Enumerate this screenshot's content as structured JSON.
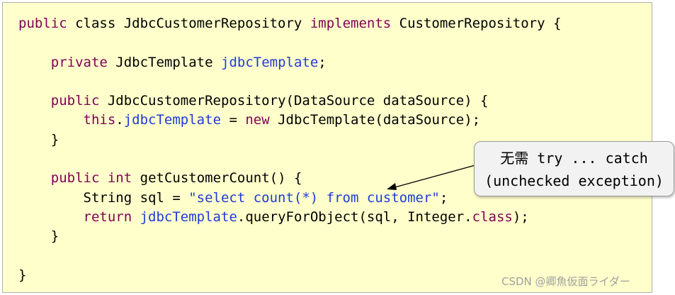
{
  "code_lines": [
    [
      {
        "t": "public",
        "c": "kw"
      },
      {
        "t": " class JdbcCustomerRepository "
      },
      {
        "t": "implements",
        "c": "kw"
      },
      {
        "t": " CustomerRepository {"
      }
    ],
    [],
    [
      {
        "t": "    "
      },
      {
        "t": "private",
        "c": "kw"
      },
      {
        "t": " JdbcTemplate "
      },
      {
        "t": "jdbcTemplate",
        "c": "fld"
      },
      {
        "t": ";"
      }
    ],
    [],
    [
      {
        "t": "    "
      },
      {
        "t": "public",
        "c": "kw"
      },
      {
        "t": " JdbcCustomerRepository(DataSource dataSource) {"
      }
    ],
    [
      {
        "t": "        "
      },
      {
        "t": "this",
        "c": "kw"
      },
      {
        "t": "."
      },
      {
        "t": "jdbcTemplate",
        "c": "fld"
      },
      {
        "t": " = "
      },
      {
        "t": "new",
        "c": "kw"
      },
      {
        "t": " JdbcTemplate(dataSource);"
      }
    ],
    [
      {
        "t": "    }"
      }
    ],
    [],
    [
      {
        "t": "    "
      },
      {
        "t": "public",
        "c": "kw"
      },
      {
        "t": " "
      },
      {
        "t": "int",
        "c": "kw"
      },
      {
        "t": " getCustomerCount() {"
      }
    ],
    [
      {
        "t": "        String sql = "
      },
      {
        "t": "\"select count(*) from customer\"",
        "c": "str"
      },
      {
        "t": ";"
      }
    ],
    [
      {
        "t": "        "
      },
      {
        "t": "return",
        "c": "kw"
      },
      {
        "t": " "
      },
      {
        "t": "jdbcTemplate",
        "c": "fld"
      },
      {
        "t": ".queryForObject(sql, Integer."
      },
      {
        "t": "class",
        "c": "kw"
      },
      {
        "t": ");"
      }
    ],
    [
      {
        "t": "    }"
      }
    ],
    [],
    [
      {
        "t": "}"
      }
    ]
  ],
  "callout": {
    "line1": "无需 try ... catch",
    "line2": "(unchecked exception)"
  },
  "watermark": "CSDN @卿魚仮面ライダー",
  "colors": {
    "panel_background": "#ffffcc",
    "keyword": "#7f0055",
    "field": "#1f3bd6",
    "string": "#1f3bd6",
    "callout_background": "#f2f2f2",
    "watermark": "#a0a0a0"
  }
}
